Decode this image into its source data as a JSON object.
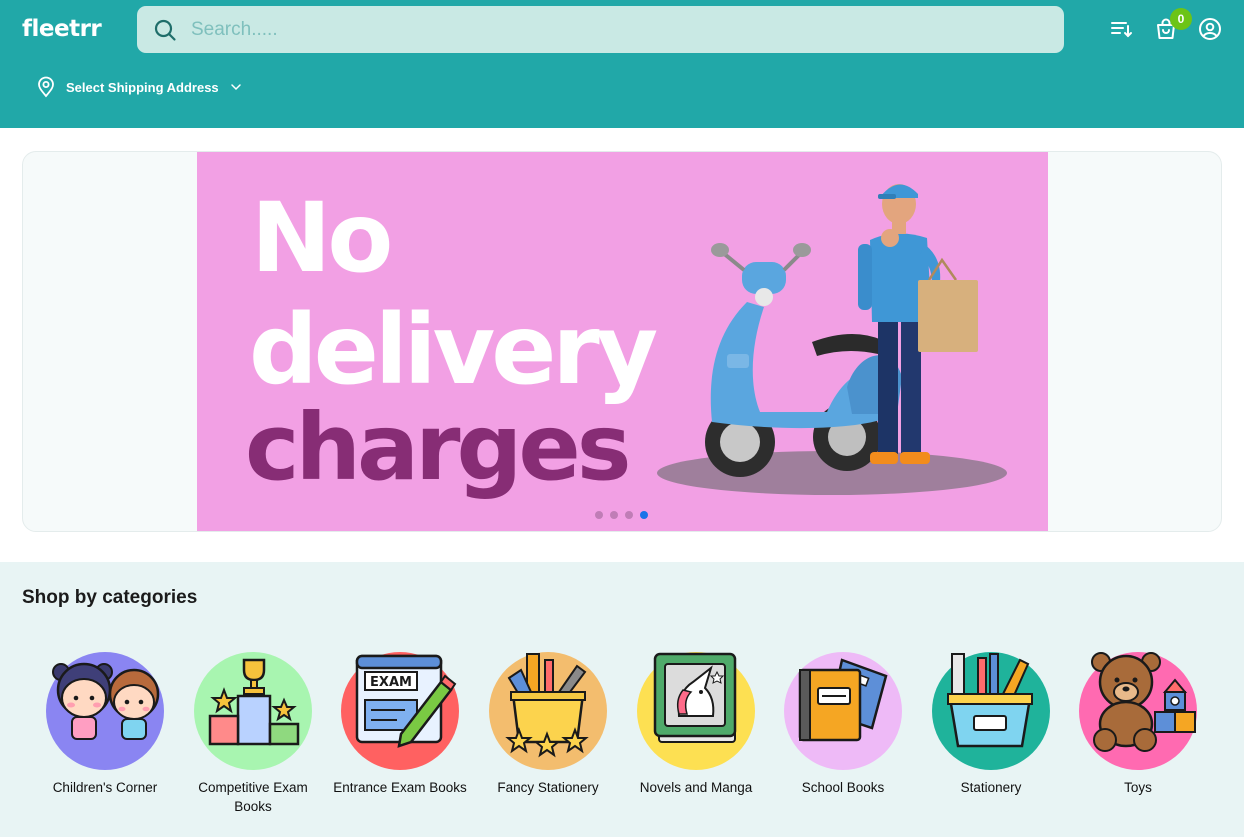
{
  "header": {
    "logo": "fleetrr",
    "search": {
      "placeholder": "Search....."
    },
    "cart_count": "0",
    "shipping_label": "Select Shipping Address"
  },
  "banner": {
    "line1": "No",
    "line2": "delivery",
    "line3": "charges",
    "slide_count": 4,
    "active_slide": 4
  },
  "categories": {
    "title": "Shop by categories",
    "items": [
      {
        "label": "Children's Corner",
        "color": "#8a85f2"
      },
      {
        "label": "Competitive Exam Books",
        "color": "#a8f5b0"
      },
      {
        "label": "Entrance Exam Books",
        "color": "#ff6161"
      },
      {
        "label": "Fancy Stationery",
        "color": "#f3bd6e"
      },
      {
        "label": "Novels and Manga",
        "color": "#fde052"
      },
      {
        "label": "School Books",
        "color": "#eebaf7"
      },
      {
        "label": "Stationery",
        "color": "#1fb39b"
      },
      {
        "label": "Toys",
        "color": "#ff6ab1"
      }
    ]
  },
  "colors": {
    "brand": "#21a8a8",
    "banner_bg": "#f2a0e4",
    "badge": "#6cc417"
  }
}
